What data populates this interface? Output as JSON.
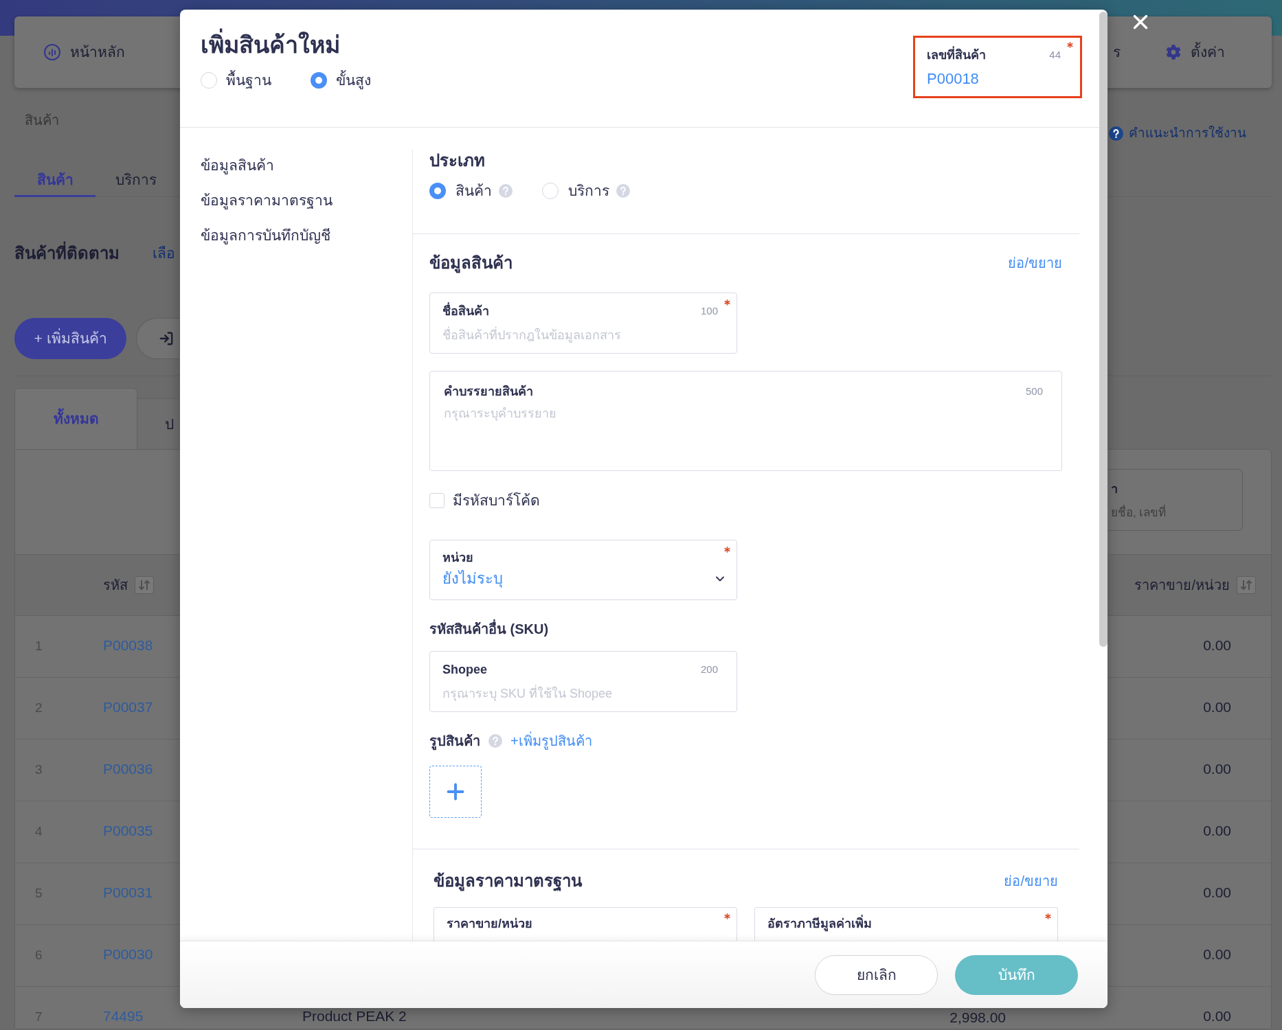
{
  "nav": {
    "items": [
      {
        "label": "หน้าหลัก",
        "kind": "dashboard"
      },
      {
        "label": "ร",
        "kind": "plain"
      },
      {
        "label": "ตั้งค่า",
        "kind": "settings"
      }
    ]
  },
  "breadcrumb": "สินค้า",
  "help_link": "คำแนะนำการใช้งาน",
  "page_tabs": [
    {
      "label": "สินค้า",
      "selected": true
    },
    {
      "label": "บริการ",
      "selected": false
    }
  ],
  "tracked": {
    "title": "สินค้าที่ติดตาม",
    "link": "เลือ"
  },
  "toolbar": [
    {
      "kind": "primary",
      "label": "+ เพิ่มสินค้า"
    },
    {
      "kind": "icon"
    }
  ],
  "list": {
    "tabs": [
      {
        "label": "ทั้งหมด",
        "selected": true
      },
      {
        "label": "ป",
        "selected": false
      }
    ],
    "search": {
      "label": "า",
      "placeholder": "ยชื่อ, เลขที่"
    },
    "table": {
      "columns": [
        {
          "label": "รหัส",
          "sortable": true
        },
        {
          "label": "ราคาขาย/หน่วย",
          "sortable": true
        }
      ],
      "rows": [
        {
          "number": "1",
          "code": "P00038",
          "price": "0.00"
        },
        {
          "number": "2",
          "code": "P00037",
          "price": "0.00"
        },
        {
          "number": "3",
          "code": "P00036",
          "price": "0.00"
        },
        {
          "number": "4",
          "code": "P00035",
          "price": "0.00"
        },
        {
          "number": "5",
          "code": "P00031",
          "price": "0.00"
        },
        {
          "number": "6",
          "code": "P00030",
          "price": "0.00"
        },
        {
          "number": "7",
          "code": "74495",
          "column_3": "Product PEAK 2",
          "column_4": "2,998.00",
          "price": "0.00"
        }
      ]
    }
  },
  "modal": {
    "title": "เพิ่มสินค้าใหม่",
    "modes": [
      {
        "label": "พื้นฐาน",
        "selected": false
      },
      {
        "label": "ขั้นสูง",
        "selected": true
      }
    ],
    "product_number": {
      "label": "เลขที่สินค้า",
      "count": "44",
      "required": true,
      "value": "P00018",
      "highlighted": true
    },
    "section_nav": [
      {
        "label": "ข้อมูลสินค้า"
      },
      {
        "label": "ข้อมูลราคามาตรฐาน"
      },
      {
        "label": "ข้อมูลการบันทึกบัญชี"
      }
    ],
    "type": {
      "title": "ประเภท",
      "options": [
        {
          "label": "สินค้า",
          "selected": true
        },
        {
          "label": "บริการ",
          "selected": false
        }
      ]
    },
    "product_info": {
      "title": "ข้อมูลสินค้า",
      "toggle": "ย่อ/ขยาย",
      "items": [
        {
          "kind": "text",
          "label": "ชื่อสินค้า",
          "count": "100",
          "required": true,
          "placeholder": "ชื่อสินค้าที่ปรากฎในข้อมูลเอกสาร"
        },
        {
          "kind": "textarea",
          "label": "คำบรรยายสินค้า",
          "count": "500",
          "required": false,
          "placeholder": "กรุณาระบุคำบรรยาย"
        },
        {
          "kind": "checkbox",
          "label": "มีรหัสบาร์โค้ด",
          "checked": false
        },
        {
          "kind": "select",
          "label": "หน่วย",
          "required": true,
          "value": "ยังไม่ระบุ"
        },
        {
          "kind": "heading",
          "label": "รหัสสินค้าอื่น (SKU)"
        },
        {
          "kind": "text",
          "label": "Shopee",
          "count": "200",
          "required": false,
          "placeholder": "กรุณาระบุ SKU ที่ใช้ใน Shopee"
        },
        {
          "kind": "images",
          "label": "รูปสินค้า",
          "link": "+เพิ่มรูปสินค้า"
        }
      ]
    },
    "price_info": {
      "title": "ข้อมูลราคามาตรฐาน",
      "toggle": "ย่อ/ขยาย",
      "fields": [
        {
          "label": "ราคาขาย/หน่วย",
          "required": true
        },
        {
          "label": "อัตราภาษีมูลค่าเพิ่ม",
          "required": true
        }
      ]
    },
    "actions": [
      {
        "label": "ยกเลิก",
        "kind": "secondary"
      },
      {
        "label": "บันทึก",
        "kind": "primary"
      }
    ]
  }
}
